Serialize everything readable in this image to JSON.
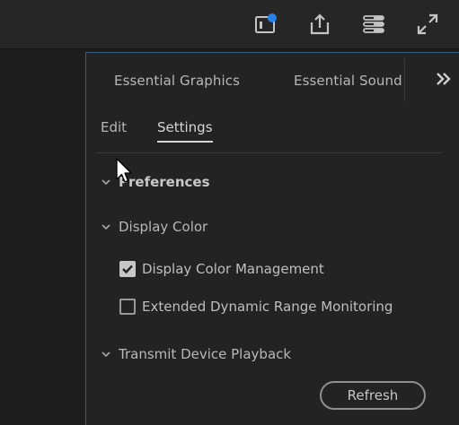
{
  "toolbar": {
    "icons": [
      "notifications-icon",
      "share-export-icon",
      "workspace-menu-icon",
      "fullscreen-icon"
    ],
    "accent": "#2680eb"
  },
  "panel": {
    "tabs": [
      {
        "label": "Essential Graphics"
      },
      {
        "label": "Essential Sound"
      }
    ],
    "overflow_icon": "double-chevron-right-icon",
    "subtabs": [
      {
        "label": "Edit",
        "active": false
      },
      {
        "label": "Settings",
        "active": true
      }
    ],
    "sections": {
      "preferences": {
        "label": "Preferences",
        "expanded": true
      },
      "display_color": {
        "label": "Display Color",
        "expanded": true,
        "options": [
          {
            "label": "Display Color Management",
            "checked": true
          },
          {
            "label": "Extended Dynamic Range Monitoring",
            "checked": false
          }
        ]
      },
      "transmit": {
        "label": "Transmit Device Playback",
        "expanded": true
      }
    },
    "refresh_label": "Refresh"
  }
}
